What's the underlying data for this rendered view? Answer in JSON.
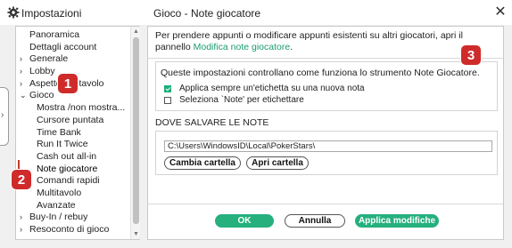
{
  "window": {
    "app_title": "Impostazioni",
    "panel_title": "Gioco - Note giocatore",
    "close_glyph": "✕"
  },
  "sidebar": {
    "items": [
      {
        "label": "Panoramica",
        "level": 0,
        "arrow": ""
      },
      {
        "label": "Dettagli account",
        "level": 0,
        "arrow": ""
      },
      {
        "label": "Generale",
        "level": 0,
        "arrow": "›"
      },
      {
        "label": "Lobby",
        "level": 0,
        "arrow": "›"
      },
      {
        "label": "Aspetto del tavolo",
        "level": 0,
        "arrow": "›"
      },
      {
        "label": "Gioco",
        "level": 0,
        "arrow": "⌄"
      },
      {
        "label": "Mostra /non mostra...",
        "level": 1,
        "arrow": ""
      },
      {
        "label": "Cursore puntata",
        "level": 1,
        "arrow": ""
      },
      {
        "label": "Time Bank",
        "level": 1,
        "arrow": ""
      },
      {
        "label": "Run It Twice",
        "level": 1,
        "arrow": ""
      },
      {
        "label": "Cash out all-in",
        "level": 1,
        "arrow": ""
      },
      {
        "label": "Note giocatore",
        "level": 1,
        "arrow": "",
        "selected": true
      },
      {
        "label": "Comandi rapidi",
        "level": 1,
        "arrow": ""
      },
      {
        "label": "Multitavolo",
        "level": 1,
        "arrow": ""
      },
      {
        "label": "Avanzate",
        "level": 1,
        "arrow": ""
      },
      {
        "label": "Buy-In / rebuy",
        "level": 0,
        "arrow": "›"
      },
      {
        "label": "Resoconto di gioco",
        "level": 0,
        "arrow": "›"
      }
    ]
  },
  "main": {
    "intro_text": "Per prendere appunti o modificare appunti esistenti su altri giocatori, apri il pannello",
    "intro_link": "Modifica note giocatore",
    "intro_end": ".",
    "settings_desc": "Queste impostazioni controllano come funziona lo strumento Note Giocatore.",
    "checkbox_1": {
      "label": "Applica sempre un'etichetta su una nuova nota",
      "checked": true
    },
    "checkbox_2": {
      "label": "Seleziona `Note' per etichettare",
      "checked": false
    },
    "section_title": "DOVE SALVARE LE NOTE",
    "path_value": "C:\\Users\\WindowsID\\Local\\PokerStars\\",
    "change_folder_label": "Cambia cartella",
    "open_folder_label": "Apri cartella",
    "ok_label": "OK",
    "cancel_label": "Annulla",
    "apply_label": "Applica modifiche"
  },
  "annotations": {
    "badge_1": "1",
    "badge_2": "2",
    "badge_3": "3"
  },
  "colors": {
    "accent_green": "#25b07e",
    "link_green": "#1a9c6e",
    "badge_red": "#cf2b2b"
  }
}
